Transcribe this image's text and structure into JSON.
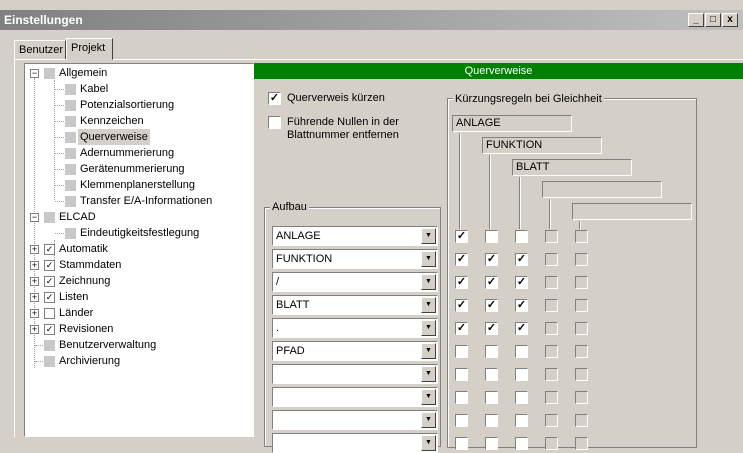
{
  "window": {
    "title": "Einstellungen",
    "minimize": "_",
    "restore": "□",
    "close": "x"
  },
  "tabs": [
    {
      "label": "Benutzer"
    },
    {
      "label": "Projekt"
    }
  ],
  "tree": {
    "nodes": [
      {
        "label": "Allgemein",
        "expander": "−",
        "checkbox": false,
        "selected": false
      },
      {
        "label": "Kabel"
      },
      {
        "label": "Potenzialsortierung"
      },
      {
        "label": "Kennzeichen"
      },
      {
        "label": "Querverweise",
        "selected": true
      },
      {
        "label": "Adernummerierung"
      },
      {
        "label": "Gerätenummerierung"
      },
      {
        "label": "Klemmenplanerstellung"
      },
      {
        "label": "Transfer E/A-Informationen"
      },
      {
        "label": "ELCAD",
        "expander": "−"
      },
      {
        "label": "Eindeutigkeitsfestlegung"
      },
      {
        "label": "Automatik",
        "expander": "+",
        "checkbox": "✓"
      },
      {
        "label": "Stammdaten",
        "expander": "+",
        "checkbox": "✓"
      },
      {
        "label": "Zeichnung",
        "expander": "+",
        "checkbox": "✓"
      },
      {
        "label": "Listen",
        "expander": "+",
        "checkbox": "✓"
      },
      {
        "label": "Länder",
        "expander": "+",
        "checkbox": ""
      },
      {
        "label": "Revisionen",
        "expander": "+",
        "checkbox": "✓"
      },
      {
        "label": "Benutzerverwaltung"
      },
      {
        "label": "Archivierung"
      }
    ]
  },
  "panel": {
    "title": "Querverweise",
    "options": [
      {
        "label": "Querverweis kürzen",
        "checked": "✓"
      },
      {
        "label": "Führende Nullen in der",
        "label2": "Blattnummer entfernen",
        "checked": ""
      }
    ],
    "aufbau": {
      "label": "Aufbau",
      "fields": [
        "ANLAGE",
        "FUNKTION",
        "/",
        "BLATT",
        ".",
        "PFAD",
        "",
        "",
        "",
        ""
      ],
      "dropdown_icon": "▼"
    },
    "kuerzung": {
      "label": "Kürzungsregeln bei Gleichheit",
      "levels": [
        "ANLAGE",
        "FUNKTION",
        "BLATT",
        "",
        ""
      ],
      "matrix": [
        [
          "✓",
          "",
          "",
          "",
          ""
        ],
        [
          "✓",
          "✓",
          "✓",
          "",
          ""
        ],
        [
          "✓",
          "✓",
          "✓",
          "",
          ""
        ],
        [
          "✓",
          "✓",
          "✓",
          "",
          ""
        ],
        [
          "✓",
          "✓",
          "✓",
          "",
          ""
        ],
        [
          "",
          "",
          "",
          "",
          ""
        ],
        [
          "",
          "",
          "",
          "",
          ""
        ],
        [
          "",
          "",
          "",
          "",
          ""
        ],
        [
          "",
          "",
          "",
          "",
          ""
        ],
        [
          "",
          "",
          "",
          "",
          ""
        ]
      ]
    }
  }
}
